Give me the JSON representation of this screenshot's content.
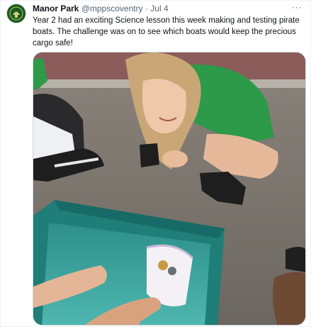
{
  "tweet": {
    "author_name": "Manor Park",
    "author_handle": "@mppscoventry",
    "separator": "·",
    "timestamp": "Jul 4",
    "text": "Year 2 had an exciting Science lesson this week making and testing pirate boats. The challenge was on to see which boats would keep the precious cargo safe!",
    "more_label": "···",
    "avatar_icon": "school-logo-icon",
    "media": {
      "kind": "photo"
    }
  },
  "colors": {
    "text_primary": "#0f1419",
    "text_secondary": "#536471",
    "border": "#cfd9de",
    "avatar_bg": "#1d5a1f"
  }
}
